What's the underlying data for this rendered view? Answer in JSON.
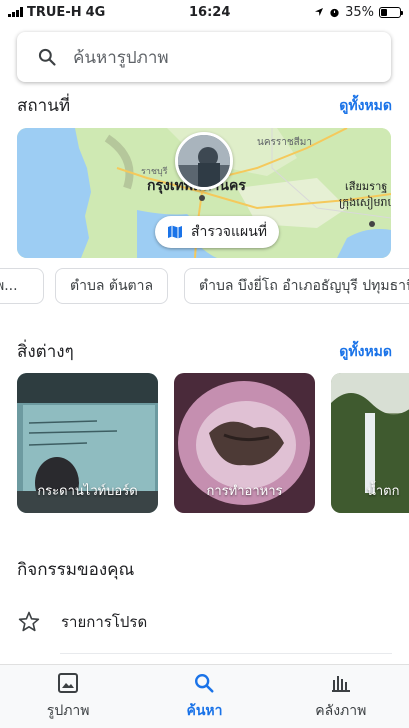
{
  "status_bar": {
    "carrier": "TRUE-H",
    "network": "4G",
    "time": "16:24",
    "battery": "35%",
    "battery_level": 0.35
  },
  "search": {
    "placeholder": "ค้นหารูปภาพ",
    "icon": "search-icon"
  },
  "places": {
    "title": "สถานที่",
    "see_all": "ดูทั้งหมด",
    "map": {
      "labels": {
        "city_main": "กรุงเทพมหานคร",
        "city_ne": "นครราชสีมา",
        "city_right": "เสียมราฐ",
        "city_right_khmer": "ក្រុងសៀមរាប",
        "city_left": "ราชบุรี"
      },
      "explore_button": "สำรวจแผนที่",
      "explore_icon": "map-icon"
    },
    "chips": [
      "พ...",
      "ตำบล ต้นตาล",
      "ตำบล บึงยี่โถ อำเภอธัญบุรี ปทุมธานี"
    ]
  },
  "things": {
    "title": "สิ่งต่างๆ",
    "see_all": "ดูทั้งหมด",
    "tiles": [
      "กระดานไวท์บอร์ด",
      "การทำอาหาร",
      "น้ำตก"
    ]
  },
  "activity": {
    "title": "กิจกรรมของคุณ",
    "favorites_label": "รายการโปรด",
    "favorites_icon": "star-icon"
  },
  "bottom_nav": [
    {
      "label": "รูปภาพ",
      "icon": "photo-icon",
      "active": false
    },
    {
      "label": "ค้นหา",
      "icon": "search-icon",
      "active": true
    },
    {
      "label": "คลังภาพ",
      "icon": "library-icon",
      "active": false
    }
  ],
  "colors": {
    "accent": "#1a73e8",
    "text": "#202124",
    "secondary": "#5f6368"
  }
}
